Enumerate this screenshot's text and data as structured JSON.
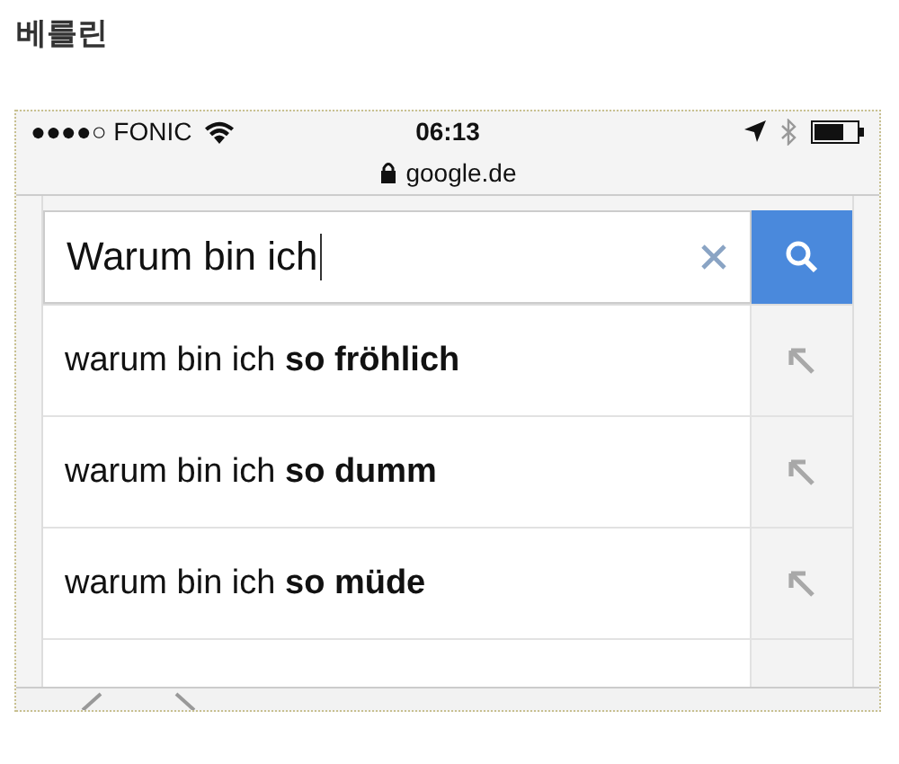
{
  "heading": "베를린",
  "status_bar": {
    "carrier": "●●●●○ FONIC",
    "time": "06:13"
  },
  "address_bar": {
    "url": "google.de"
  },
  "search": {
    "value": "Warum bin ich"
  },
  "suggestions": [
    {
      "text": "warum bin ich **so fröhlich**"
    },
    {
      "text": "warum bin ich **so dumm**"
    },
    {
      "text": "warum bin ich **so müde**"
    }
  ]
}
